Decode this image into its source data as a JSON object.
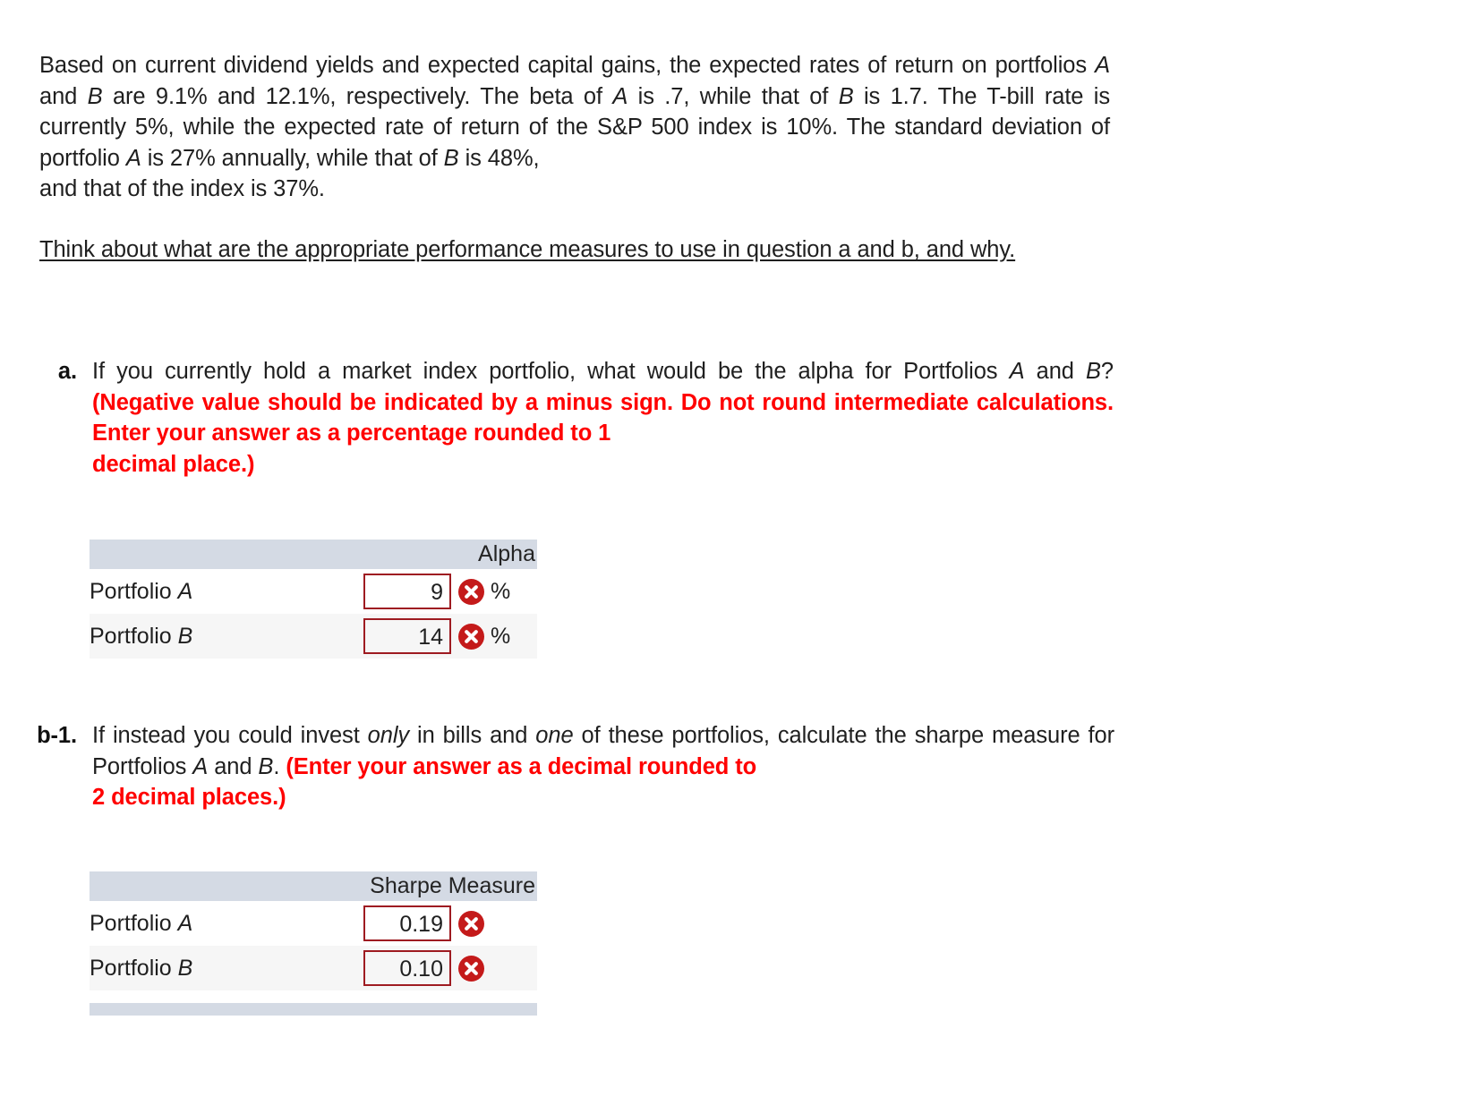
{
  "problem": {
    "intro_lines": [
      "Based on current dividend yields and expected capital gains, the expected rates of",
      "return on portfolios A and B are 9.1% and 12.1%, respectively. The beta of A is .7, while that",
      "of B is 1.7. The T-bill rate is currently 5%, while the expected rate of return of the S&P 500",
      "index is 10%. The standard deviation of portfolio A is 27% annually, while that of B is 48%,",
      "and that of the index is 37%."
    ],
    "intro_full": "Based on current dividend yields and expected capital gains, the expected rates of return on portfolios A and B are 9.1% and 12.1%, respectively. The beta of A is .7, while that of B is 1.7. The T-bill rate is currently 5%, while the expected rate of return of the S&P 500 index is 10%. The standard deviation of portfolio A is 27% annually, while that of B is 48%, and that of the index is 37%.",
    "note": "Think about what are the appropriate performance measures to use in question a and b, and why."
  },
  "question_a": {
    "marker": "a.",
    "text_plain": "If you currently hold a market index portfolio, what would be the alpha for Portfolios A and B?",
    "text_red": "(Negative value should be indicated by a minus sign. Do not round intermediate calculations. Enter your answer as a percentage rounded to 1 decimal place.)",
    "part1": "If you currently hold a market index portfolio, what would be the alpha for Portfolios ",
    "part2": "A",
    "part3": " and ",
    "part4": "B",
    "part5": "? ",
    "table": {
      "header_label": "Alpha",
      "rows": [
        {
          "label_text": "Portfolio ",
          "label_italic": "A",
          "value": "9",
          "unit": "%",
          "status": "incorrect"
        },
        {
          "label_text": "Portfolio ",
          "label_italic": "B",
          "value": "14",
          "unit": "%",
          "status": "incorrect"
        }
      ]
    }
  },
  "question_b1": {
    "marker": "b-1.",
    "text_plain": "If instead you could invest only in bills and one of these portfolios, calculate the sharpe measure for Portfolios A and B.",
    "text_red": "(Enter your answer as a decimal rounded to 2 decimal places.)",
    "seg1": "If instead you could invest ",
    "seg2": "only",
    "seg3": " in bills and ",
    "seg4": "one",
    "seg5": " of these portfolios, calculate the sharpe measure for Portfolios ",
    "seg6": "A",
    "seg7": " and ",
    "seg8": "B",
    "seg9": ". ",
    "table": {
      "header_label": "Sharpe Measure",
      "rows": [
        {
          "label_text": "Portfolio ",
          "label_italic": "A",
          "value": "0.19",
          "unit": "",
          "status": "incorrect"
        },
        {
          "label_text": "Portfolio ",
          "label_italic": "B",
          "value": "0.10",
          "unit": "",
          "status": "incorrect"
        }
      ]
    }
  },
  "icons": {
    "incorrect": "x-circle-icon"
  },
  "colors": {
    "red_instruction": "#ff0000",
    "table_header_bg": "#d4dae4",
    "row_alt_bg": "#f6f6f6",
    "input_border": "#9e1b21",
    "incorrect_badge": "#c41a1a",
    "text": "#1f1f1f"
  }
}
